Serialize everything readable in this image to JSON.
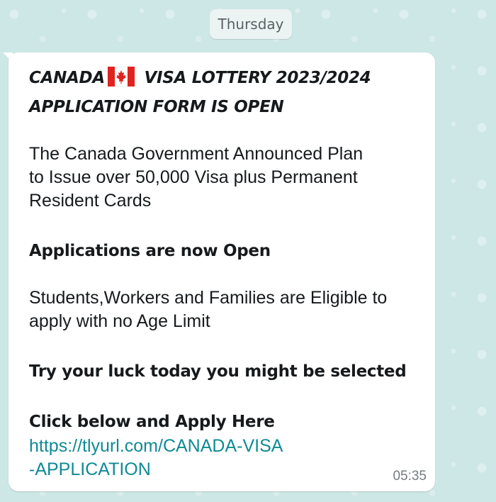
{
  "date_label": "Thursday",
  "message": {
    "headline_line1_left": "CANADA",
    "headline_line1_right": "VISA LOTTERY 2023/2024",
    "headline_line2": "APPLICATION FORM IS OPEN",
    "flag_icon": "canada-flag-icon",
    "paragraph1_lines": [
      "The Canada Government Announced Plan",
      "to Issue over 50,000 Visa plus Permanent",
      "Resident Cards"
    ],
    "applications_open": "Applications are now Open",
    "paragraph2_lines": [
      "Students,Workers and Families are Eligible to",
      "apply with no Age Limit"
    ],
    "try_luck": "Try your luck today you might be selected",
    "click_below": "Click below and Apply Here",
    "link_lines": [
      "https://tlyurl.com/CANADA-VISA",
      "-APPLICATION"
    ],
    "time": "05:35"
  },
  "colors": {
    "wallpaper": "#cde6e6",
    "bubble": "#ffffff",
    "link": "#0f8a94",
    "flag_red": "#e0231f"
  }
}
